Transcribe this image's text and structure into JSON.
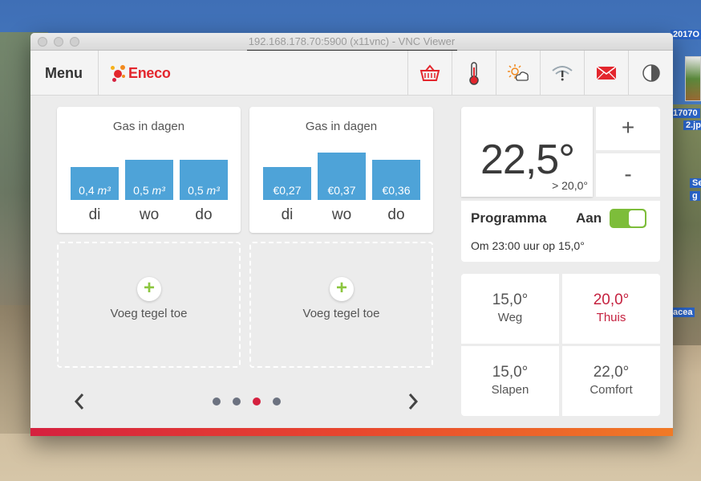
{
  "desktop": {
    "labels": [
      "2017O",
      "17070",
      "2.jp",
      "Se",
      "g",
      "acea"
    ]
  },
  "window": {
    "title": "192.168.178.70:5900 (x11vnc) - VNC Viewer"
  },
  "header": {
    "menu_label": "Menu",
    "brand": "Eneco",
    "icons": [
      "basket-icon",
      "thermometer-icon",
      "weather-icon",
      "wifi-alert-icon",
      "mail-icon",
      "dim-icon"
    ],
    "colors": {
      "brand": "#e3262d",
      "accent": "#4ea3d8",
      "active": "#c5213f",
      "toggle": "#7dbd3a"
    }
  },
  "tiles": [
    {
      "title": "Gas in dagen",
      "bars": [
        {
          "label": "0,4",
          "unit": "m³",
          "day": "di",
          "value": 0.4
        },
        {
          "label": "0,5",
          "unit": "m³",
          "day": "wo",
          "value": 0.5
        },
        {
          "label": "0,5",
          "unit": "m³",
          "day": "do",
          "value": 0.5
        }
      ]
    },
    {
      "title": "Gas in dagen",
      "bars": [
        {
          "label": "€0,27",
          "day": "di",
          "value": 0.27
        },
        {
          "label": "€0,37",
          "day": "wo",
          "value": 0.37
        },
        {
          "label": "€0,36",
          "day": "do",
          "value": 0.36
        }
      ]
    }
  ],
  "add_tiles": [
    {
      "label": "Voeg tegel toe"
    },
    {
      "label": "Voeg tegel toe"
    }
  ],
  "pagination": {
    "pages": 4,
    "active": 3
  },
  "thermostat": {
    "current": "22,5°",
    "setpoint": "> 20,0°",
    "plus": "+",
    "minus": "-"
  },
  "program": {
    "label": "Programma",
    "state": "Aan",
    "enabled": true,
    "note": "Om 23:00 uur op 15,0°"
  },
  "presets": [
    {
      "temp": "15,0°",
      "name": "Weg",
      "active": false
    },
    {
      "temp": "20,0°",
      "name": "Thuis",
      "active": true
    },
    {
      "temp": "15,0°",
      "name": "Slapen",
      "active": false
    },
    {
      "temp": "22,0°",
      "name": "Comfort",
      "active": false
    }
  ]
}
